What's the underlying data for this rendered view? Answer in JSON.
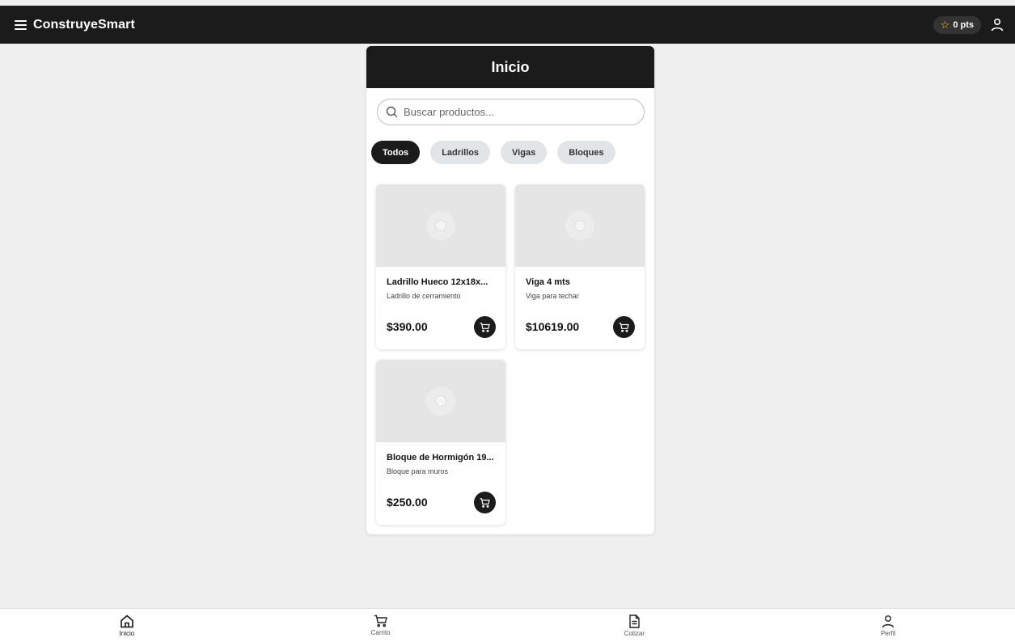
{
  "header": {
    "title": "ConstruyeSmart",
    "points": "0 pts"
  },
  "panel": {
    "title": "Inicio",
    "search": {
      "placeholder": "Buscar productos..."
    },
    "categories": [
      {
        "label": "Todos",
        "active": true
      },
      {
        "label": "Ladrillos",
        "active": false
      },
      {
        "label": "Vigas",
        "active": false
      },
      {
        "label": "Bloques",
        "active": false
      }
    ],
    "products": [
      {
        "name": "Ladrillo Hueco 12x18x...",
        "description": "Ladrillo de cerramiento",
        "price": "$390.00"
      },
      {
        "name": "Viga 4 mts",
        "description": "Viga para techar",
        "price": "$10619.00"
      },
      {
        "name": "Bloque de Hormigón 19...",
        "description": "Bloque para muros",
        "price": "$250.00"
      }
    ]
  },
  "bottom_nav": [
    {
      "label": "Inicio",
      "icon": "home-icon",
      "active": true
    },
    {
      "label": "Carrito",
      "icon": "cart-icon",
      "active": false
    },
    {
      "label": "Cotizar",
      "icon": "document-icon",
      "active": false
    },
    {
      "label": "Perfil",
      "icon": "user-icon",
      "active": false
    }
  ],
  "colors": {
    "dark": "#1b1b1b",
    "star": "#f3c623",
    "background": "#efefef",
    "chip": "#e2e5e8"
  }
}
